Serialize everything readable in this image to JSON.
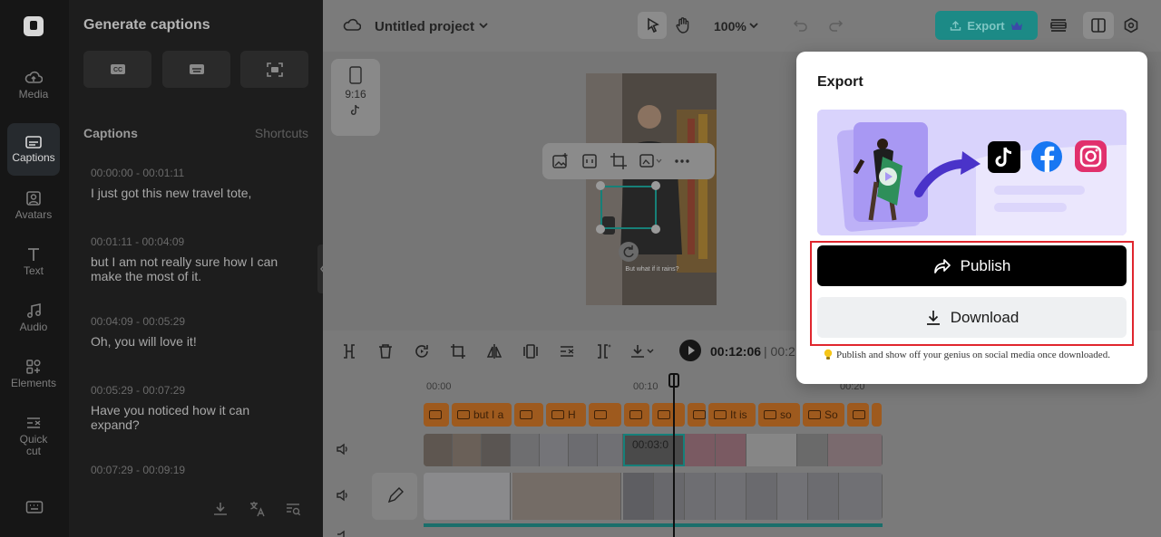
{
  "sidebar": {
    "items": [
      {
        "label": "Media",
        "icon": "cloud-upload-icon"
      },
      {
        "label": "Captions",
        "icon": "captions-icon"
      },
      {
        "label": "Avatars",
        "icon": "avatar-icon"
      },
      {
        "label": "Text",
        "icon": "text-icon"
      },
      {
        "label": "Audio",
        "icon": "music-icon"
      },
      {
        "label": "Elements",
        "icon": "elements-icon"
      },
      {
        "label": "Quick cut",
        "icon": "quick-cut-icon"
      }
    ]
  },
  "panel": {
    "title": "Generate captions",
    "section": "Captions",
    "shortcuts": "Shortcuts",
    "captions": [
      {
        "time": "00:00:00 - 00:01:11",
        "text": "I just got this new travel tote,"
      },
      {
        "time": "00:01:11 - 00:04:09",
        "text": "but I am not really sure how I can make the most of it."
      },
      {
        "time": "00:04:09 - 00:05:29",
        "text": "Oh, you will love it!"
      },
      {
        "time": "00:05:29 - 00:07:29",
        "text": "Have you noticed how it can expand?"
      },
      {
        "time": "00:07:29 - 00:09:19",
        "text": ""
      }
    ]
  },
  "header": {
    "project_name": "Untitled project",
    "zoom": "100%",
    "export_label": "Export"
  },
  "canvas": {
    "ratio_label": "9:16",
    "overlay_caption": "But what if it rains?"
  },
  "timeline": {
    "current_time": "00:12:06",
    "total_time_partial": "| 00:2",
    "ruler": [
      "00:00",
      "00:10",
      "00:20"
    ],
    "caption_clips": [
      "but I a",
      "",
      "H",
      "",
      "",
      "",
      "It is",
      "so",
      "So",
      ""
    ],
    "selected_clip_time": "00:03:0"
  },
  "export_popup": {
    "title": "Export",
    "publish_label": "Publish",
    "download_label": "Download",
    "note": "Publish and show off your genius on social media once downloaded.",
    "social_icons": [
      "tiktok-icon",
      "facebook-icon",
      "instagram-icon"
    ]
  },
  "colors": {
    "accent_teal": "#1c8a86",
    "highlight_red": "#e0262e",
    "caption_clip": "#9e5a1e",
    "hero_purple": "#d9d3fc"
  }
}
